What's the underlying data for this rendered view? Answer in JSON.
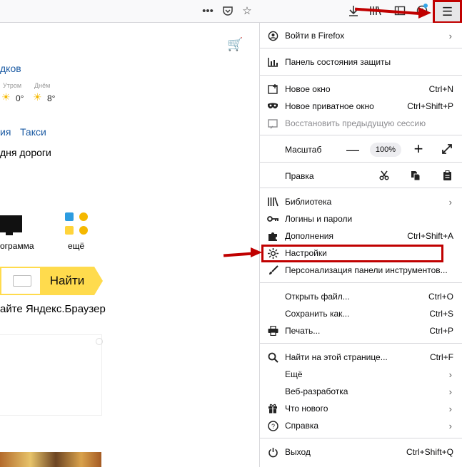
{
  "page": {
    "weather_link": "дков",
    "weather_morning": "Утром",
    "weather_day": "Днём",
    "morning_temp": "0°",
    "day_temp": "8°",
    "link_ia": "ия",
    "link_taxi": "Такси",
    "roads_text": "дня дороги",
    "program_label": "ограмма",
    "more_label": "ещё",
    "search_button": "Найти",
    "browser_text": "айте Яндекс.Браузер"
  },
  "menu": {
    "sign_in": "Войти в Firefox",
    "protection": "Панель состояния защиты",
    "new_window": "Новое окно",
    "new_window_sc": "Ctrl+N",
    "private_window": "Новое приватное окно",
    "private_window_sc": "Ctrl+Shift+P",
    "restore_session": "Восстановить предыдущую сессию",
    "zoom": "Масштаб",
    "zoom_minus": "—",
    "zoom_value": "100%",
    "zoom_plus": "+",
    "edit": "Правка",
    "library": "Библиотека",
    "logins": "Логины и пароли",
    "addons": "Дополнения",
    "addons_sc": "Ctrl+Shift+A",
    "settings": "Настройки",
    "customize": "Персонализация панели инструментов...",
    "open_file": "Открыть файл...",
    "open_file_sc": "Ctrl+O",
    "save_as": "Сохранить как...",
    "save_as_sc": "Ctrl+S",
    "print": "Печать...",
    "print_sc": "Ctrl+P",
    "find": "Найти на этой странице...",
    "find_sc": "Ctrl+F",
    "more": "Ещё",
    "web_dev": "Веб-разработка",
    "whats_new": "Что нового",
    "help": "Справка",
    "quit": "Выход",
    "quit_sc": "Ctrl+Shift+Q"
  },
  "colors": {
    "highlight_red": "#c00000",
    "yandex_yellow": "#ffdb4d",
    "link_blue": "#1d5ca4"
  },
  "icons": [
    "more-dots-icon",
    "pocket-icon",
    "bookmark-star-icon",
    "download-icon",
    "library-icon",
    "sidebar-icon",
    "account-icon",
    "hamburger-menu-icon",
    "cart-icon"
  ]
}
